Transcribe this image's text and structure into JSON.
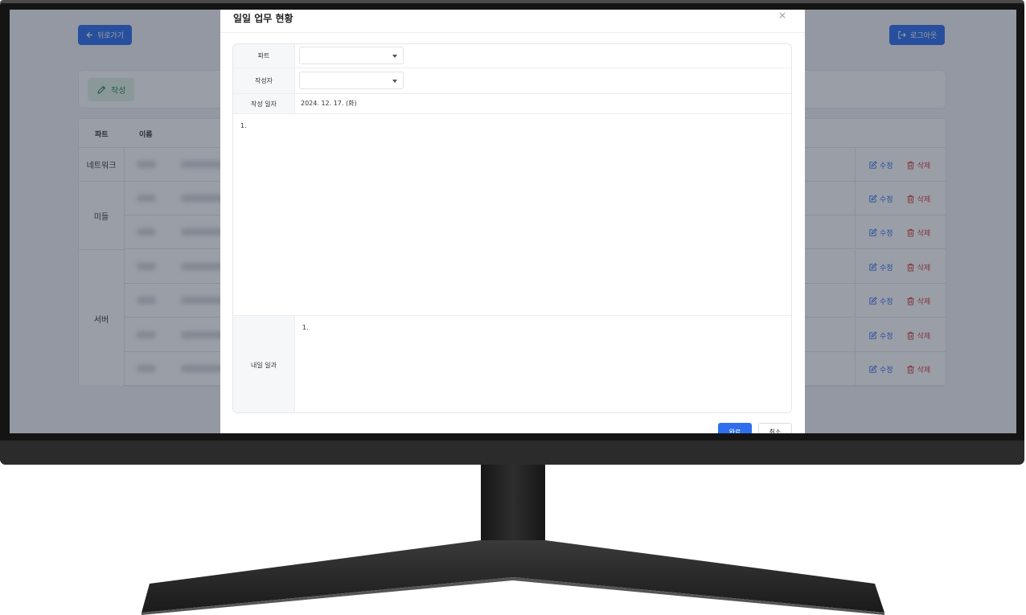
{
  "app": {
    "back_label": "뒤로가기",
    "logout_label": "로그아웃",
    "write_label": "작성"
  },
  "table": {
    "headers": [
      "파트",
      "이름"
    ],
    "parts": [
      "네트워크",
      "미들",
      "서버"
    ],
    "actions": {
      "edit": "수정",
      "delete": "삭제"
    }
  },
  "modal": {
    "title": "일일 업무 현황",
    "close": "×",
    "fields": {
      "part_label": "파트",
      "author_label": "작성자",
      "date_label": "작성 일자",
      "date_value": "2024. 12. 17. (화)",
      "today_content": "1.",
      "tomorrow_label": "내일 일과",
      "tomorrow_content": "1."
    },
    "done_label": "완료",
    "cancel_label": "취소"
  },
  "colors": {
    "primary": "#2f6fed",
    "success_bg": "#e3f4e8",
    "danger": "#d93a3a"
  }
}
